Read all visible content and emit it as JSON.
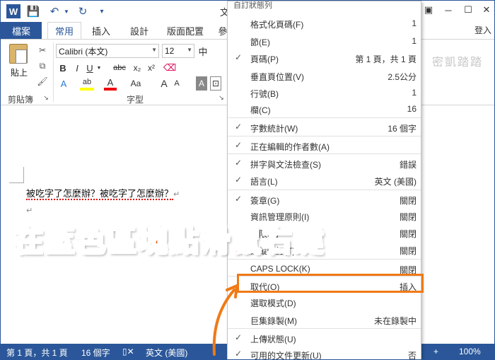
{
  "titlebar": {
    "title": "文",
    "minimize": "─",
    "close": "✕"
  },
  "tabs": {
    "file": "檔案",
    "home": "常用",
    "insert": "插入",
    "design": "設計",
    "layout": "版面配置",
    "truncated": "參",
    "login": "登入"
  },
  "ribbon": {
    "paste": "貼上",
    "clipboard_group": "剪貼簿",
    "font_group": "字型",
    "font_name": "Calibri (本文)",
    "font_size": "12",
    "bold": "B",
    "italic": "I",
    "underline": "U",
    "strike": "abc",
    "subscript": "x₂",
    "superscript": "x²",
    "font_a_grow": "A",
    "font_a_shrink": "A",
    "change_case": "Aa",
    "char_shading": "A",
    "text_effect": "A",
    "highlight": "ab",
    "font_color": "A",
    "right_watermark": "密凱踏踏",
    "zh_char": "中"
  },
  "document": {
    "line1": "被吃字了怎麼辦？被吃字了怎麼辦？",
    "pilcrow": "↵"
  },
  "statusbar": {
    "page": "第 1 頁，共 1 頁",
    "words": "16 個字",
    "proofing_icon": "📖",
    "language": "英文 (美國)",
    "zoom": "100%"
  },
  "menu": {
    "header": "自訂狀態列",
    "items": [
      {
        "label": "格式化頁碼(F)",
        "value": "1",
        "checked": false
      },
      {
        "label": "節(E)",
        "value": "1",
        "checked": false
      },
      {
        "label": "頁碼(P)",
        "value": "第 1 頁，共 1 頁",
        "checked": true
      },
      {
        "label": "垂直頁位置(V)",
        "value": "2.5公分",
        "checked": false
      },
      {
        "label": "行號(B)",
        "value": "1",
        "checked": false
      },
      {
        "label": "欄(C)",
        "value": "16",
        "checked": false
      },
      {
        "label": "字數統計(W)",
        "value": "16 個字",
        "checked": true
      },
      {
        "label": "正在編輯的作者數(A)",
        "value": "",
        "checked": true
      },
      {
        "label": "拼字與文法檢查(S)",
        "value": "錯誤",
        "checked": true
      },
      {
        "label": "語言(L)",
        "value": "英文 (美國)",
        "checked": true
      },
      {
        "label": "簽章(G)",
        "value": "關閉",
        "checked": true
      },
      {
        "label": "資訊管理原則(I)",
        "value": "關閉",
        "checked": false
      },
      {
        "label": "權限(P)",
        "value": "關閉",
        "checked": true
      },
      {
        "label": "追蹤修訂(T)",
        "value": "關閉",
        "checked": false
      },
      {
        "label": "CAPS LOCK(K)",
        "value": "關閉",
        "checked": false
      },
      {
        "label": "取代(O)",
        "value": "插入",
        "checked": false
      },
      {
        "label": "選取模式(D)",
        "value": "",
        "checked": false
      },
      {
        "label": "巨集錄製(M)",
        "value": "未在錄製中",
        "checked": false
      },
      {
        "label": "上傳狀態(U)",
        "value": "",
        "checked": true
      },
      {
        "label": "可用的文件更新(U)",
        "value": "否",
        "checked": true
      }
    ]
  },
  "annotation": {
    "text": "在藍色區塊點滑鼠右鍵"
  },
  "colors": {
    "word_blue": "#2b579a",
    "highlight_orange": "#f07a16"
  }
}
